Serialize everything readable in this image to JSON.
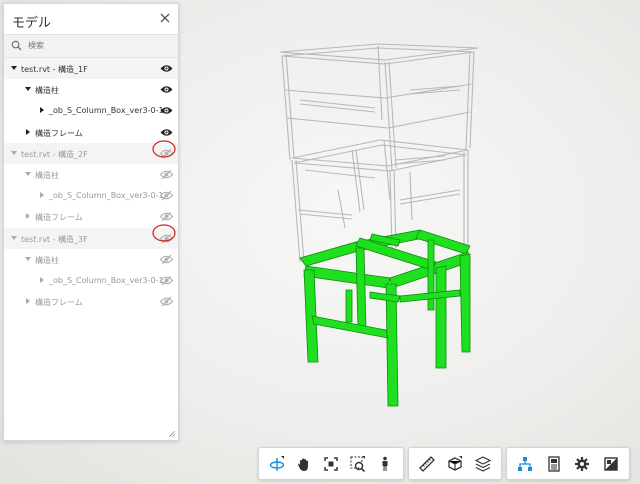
{
  "panel": {
    "title": "モデル",
    "search_placeholder": "検索"
  },
  "tree": [
    {
      "label": "test.rvt - 構造_1F",
      "level": 0,
      "caret": "down",
      "visible": true
    },
    {
      "label": "構造柱",
      "level": 1,
      "caret": "down",
      "visible": true
    },
    {
      "label": "_ob_S_Column_Box_ver3-0-1",
      "level": 2,
      "caret": "right",
      "visible": true
    },
    {
      "label": "構造フレーム",
      "level": 1,
      "caret": "right",
      "visible": true
    },
    {
      "label": "test.rvt - 構造_2F",
      "level": 0,
      "caret": "down",
      "visible": false
    },
    {
      "label": "構造柱",
      "level": 1,
      "caret": "down",
      "visible": false
    },
    {
      "label": "_ob_S_Column_Box_ver3-0-1",
      "level": 2,
      "caret": "right",
      "visible": false
    },
    {
      "label": "構造フレーム",
      "level": 1,
      "caret": "right",
      "visible": false
    },
    {
      "label": "test.rvt - 構造_3F",
      "level": 0,
      "caret": "down",
      "visible": false
    },
    {
      "label": "構造柱",
      "level": 1,
      "caret": "down",
      "visible": false
    },
    {
      "label": "_ob_S_Column_Box_ver3-0-1",
      "level": 2,
      "caret": "right",
      "visible": false
    },
    {
      "label": "構造フレーム",
      "level": 1,
      "caret": "right",
      "visible": false
    }
  ],
  "colors": {
    "accent": "#1a8cd8",
    "highlight_structure": "#1fe01f",
    "annotation_circle": "#d42020"
  },
  "toolbar": {
    "navigation": [
      "orbit-icon",
      "pan-icon",
      "fit-view-icon",
      "zoom-icon",
      "first-person-icon"
    ],
    "analysis": [
      "measure-icon",
      "section-icon",
      "explode-icon"
    ],
    "panels": [
      "model-browser-icon",
      "properties-icon",
      "settings-icon",
      "fullscreen-icon"
    ]
  }
}
